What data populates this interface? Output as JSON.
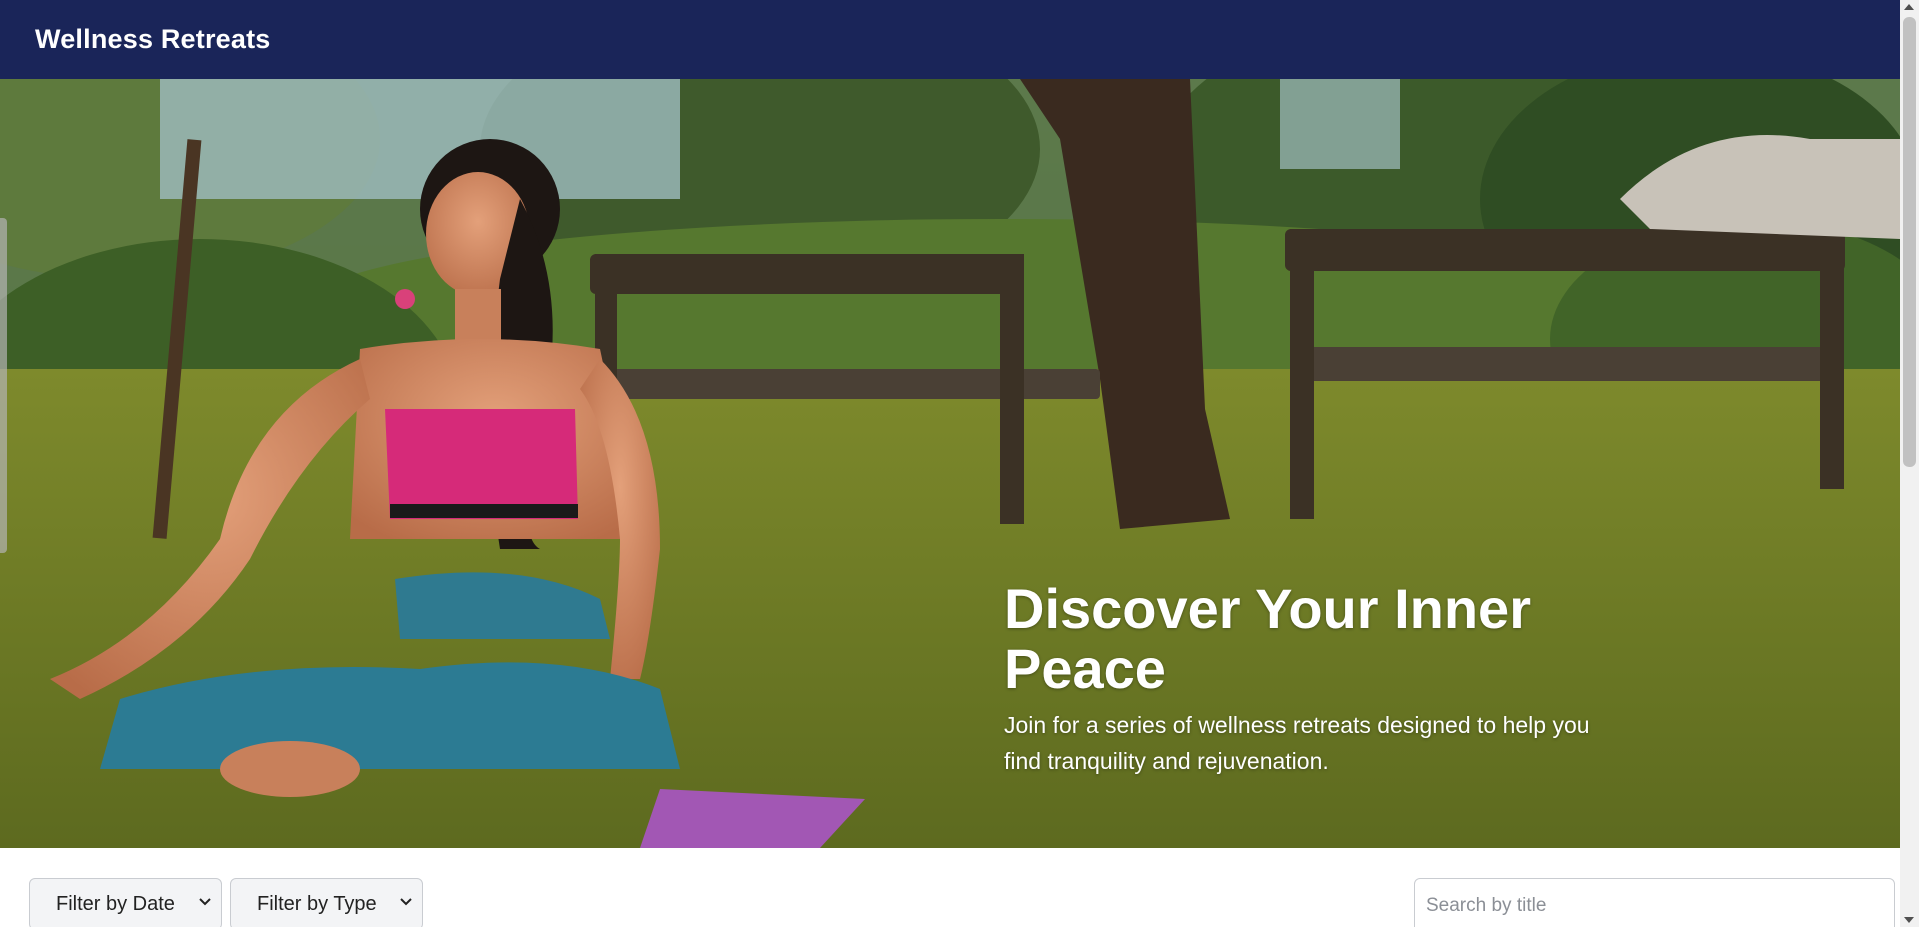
{
  "header": {
    "brand": "Wellness Retreats"
  },
  "hero": {
    "title": "Discover Your Inner Peace",
    "subtitle": "Join for a series of wellness retreats designed to help you find tranquility and rejuvenation."
  },
  "filters": {
    "date_label": "Filter by Date",
    "type_label": "Filter by Type",
    "search_placeholder": "Search by title"
  },
  "icons": {
    "date_chevron": "chevron-down-icon",
    "type_chevron": "chevron-down-icon"
  },
  "colors": {
    "header_bg": "#1a2559",
    "hero_text": "#ffffff"
  }
}
